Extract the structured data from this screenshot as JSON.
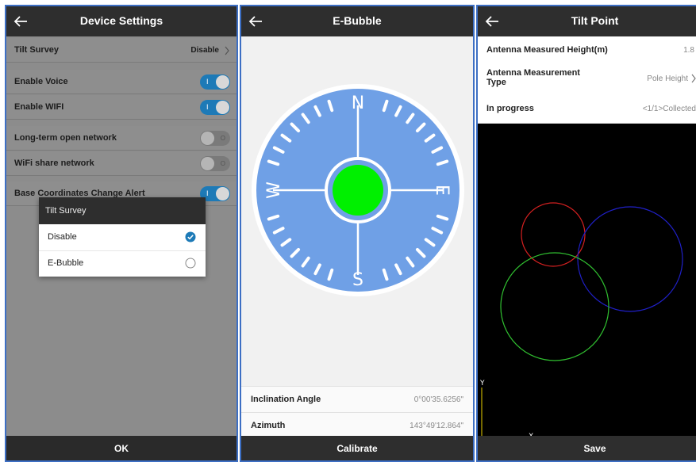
{
  "device_settings": {
    "title": "Device Settings",
    "rows": [
      {
        "label": "Tilt Survey",
        "value": "Disable"
      },
      {
        "label": "Enable Voice"
      },
      {
        "label": "Enable WIFI"
      },
      {
        "label": "Long-term open network"
      },
      {
        "label": "WiFi share network"
      },
      {
        "label": "Base Coordinates Change Alert"
      }
    ],
    "toggle_on_mark": "I",
    "toggle_off_mark": "O",
    "dialog": {
      "title": "Tilt Survey",
      "options": [
        "Disable",
        "E-Bubble"
      ],
      "selected": "Disable"
    },
    "ok_label": "OK"
  },
  "ebubble": {
    "title": "E-Bubble",
    "compass": {
      "north": "N",
      "south": "S",
      "east": "E",
      "west": "W"
    },
    "inclination_label": "Inclination Angle",
    "inclination_value": "0°00'35.6256\"",
    "azimuth_label": "Azimuth",
    "azimuth_value": "143°49'12.864\"",
    "calibrate_label": "Calibrate"
  },
  "tilt_point": {
    "title": "Tilt Point",
    "antenna_height_label": "Antenna Measured Height(m)",
    "antenna_height_value": "1.8",
    "antenna_type_label": "Antenna Measurement Type",
    "antenna_type_label_line1": "Antenna Measurement",
    "antenna_type_label_line2": "Type",
    "antenna_type_value": "Pole Height",
    "progress_label": "In progress",
    "progress_value": "<1/1>Collected",
    "plot_axis_x": "X",
    "plot_axis_y": "Y",
    "save_label": "Save"
  },
  "colors": {
    "accent_blue": "#1d7ab7",
    "compass_blue": "#6fa0e6",
    "bubble_green": "#00f000",
    "circle_red": "#d42020",
    "circle_blue": "#2020c8",
    "circle_green": "#30c030",
    "axis_yellow": "#e8d000"
  }
}
